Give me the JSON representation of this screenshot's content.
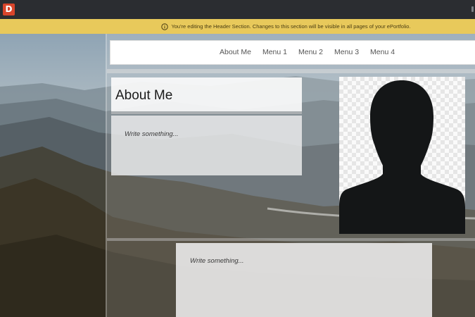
{
  "app": {
    "logo_letter": "D"
  },
  "notice": {
    "text": "You're editing the Header Section. Changes to this section will be visible in all pages of your ePortfolio.",
    "icon": "info-circle-icon"
  },
  "nav": {
    "items": [
      {
        "label": "About Me"
      },
      {
        "label": "Menu 1"
      },
      {
        "label": "Menu 2"
      },
      {
        "label": "Menu 3"
      },
      {
        "label": "Menu 4"
      }
    ]
  },
  "about": {
    "title": "About Me",
    "placeholder_1": "Write something...",
    "avatar_icon": "silhouette-avatar-icon"
  },
  "second_section": {
    "placeholder": "Write something..."
  },
  "colors": {
    "notice_bg": "#e8c95b",
    "logo_bg": "#d9452b",
    "topbar_bg": "#2b2d31"
  }
}
